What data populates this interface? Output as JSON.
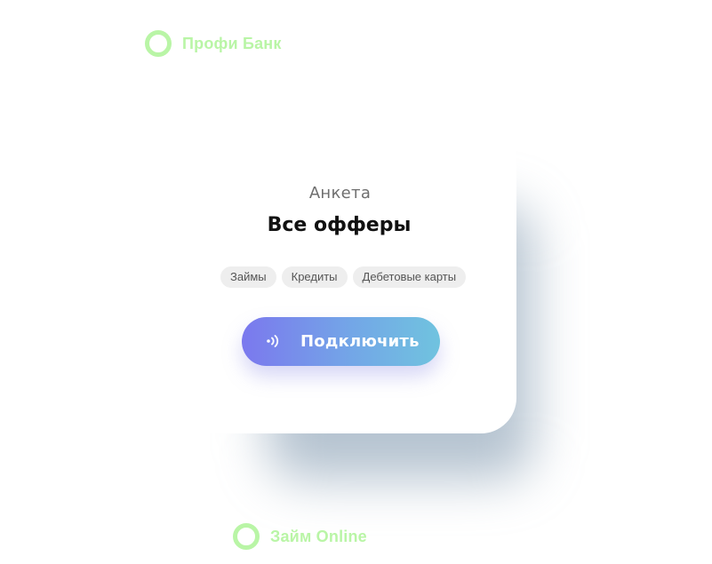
{
  "brand_top": {
    "name": "Профи Банк",
    "icon": "ring-logo-icon",
    "color": "#b9f5a6"
  },
  "card": {
    "subtitle": "Анкета",
    "title": "Все офферы",
    "tags": [
      "Займы",
      "Кредиты",
      "Дебетовые карты"
    ],
    "cta": {
      "label": "Подключить",
      "icon": "contactless-signal-icon",
      "gradient": [
        "#7b78ee",
        "#70c3df"
      ]
    }
  },
  "brand_bottom": {
    "name": "Займ Online",
    "icon": "ring-logo-icon",
    "color": "#b9f5a6"
  }
}
